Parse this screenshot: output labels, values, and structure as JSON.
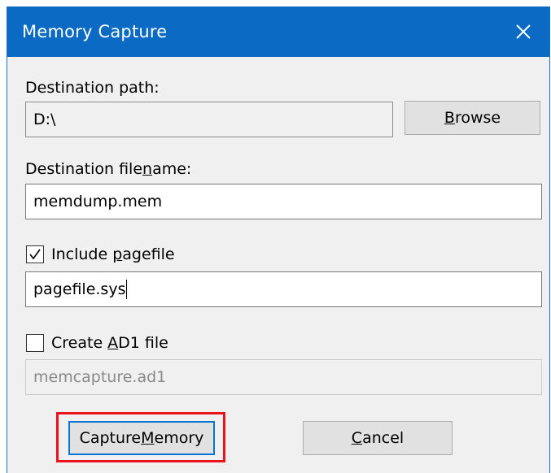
{
  "window": {
    "title": "Memory Capture",
    "close_icon": "close-icon"
  },
  "destination_path": {
    "label_pre": "Destination path:",
    "value": "D:\\",
    "browse_pre": "",
    "browse_key": "B",
    "browse_post": "rowse"
  },
  "destination_filename": {
    "label_pre": "Destination file",
    "label_key": "n",
    "label_post": "ame:",
    "value": "memdump.mem"
  },
  "pagefile": {
    "checked": true,
    "label_pre": "Include ",
    "label_key": "p",
    "label_post": "agefile",
    "value": "pagefile.sys"
  },
  "ad1": {
    "checked": false,
    "label_pre": "Create ",
    "label_key": "A",
    "label_post": "D1 file",
    "placeholder": "memcapture.ad1"
  },
  "buttons": {
    "capture_pre": "Capture ",
    "capture_key": "M",
    "capture_post": "emory",
    "cancel_pre": "",
    "cancel_key": "C",
    "cancel_post": "ancel"
  },
  "colors": {
    "titlebar": "#0a6ac4",
    "highlight": "#e8141c",
    "default_button_border": "#0a74d4"
  }
}
